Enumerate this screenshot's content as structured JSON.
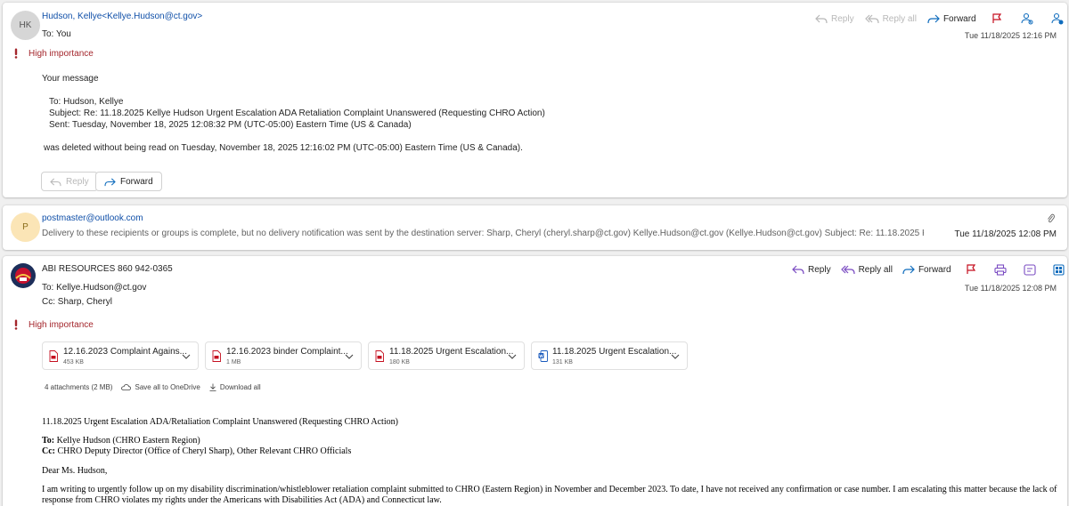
{
  "email1": {
    "avatar_initials": "HK",
    "sender": "Hudson, Kellye<Kellye.Hudson@ct.gov>",
    "to_line": "To:  You",
    "date": "Tue 11/18/2025 12:16 PM",
    "importance": "High importance",
    "actions": {
      "reply": "Reply",
      "reply_all": "Reply all",
      "forward": "Forward"
    },
    "body": {
      "your_message": "Your message",
      "to": "To: Hudson, Kellye",
      "subject": "Subject: Re: 11.18.2025 Kellye Hudson Urgent Escalation ADA Retaliation Complaint Unanswered (Requesting CHRO Action)",
      "sent": "Sent: Tuesday, November 18, 2025 12:08:32 PM (UTC-05:00) Eastern Time (US & Canada)",
      "deleted": "was deleted without being read on Tuesday, November 18, 2025 12:16:02 PM (UTC-05:00) Eastern Time (US & Canada)."
    },
    "footer_buttons": {
      "reply": "Reply",
      "forward": "Forward"
    }
  },
  "email2": {
    "avatar_initials": "P",
    "sender": "postmaster@outlook.com",
    "preview": "Delivery to these recipients or groups is complete, but no delivery notification was sent by the destination server: Sharp, Cheryl (cheryl.sharp@ct.gov) Kellye.Hudson@ct.gov (Kellye.Hudson@ct.gov) Subject: Re: 11.18.2025 Kellye Hudson ...",
    "date": "Tue 11/18/2025 12:08 PM"
  },
  "email3": {
    "sender": "ABI RESOURCES 860 942-0365",
    "to_line": "To:  Kellye.Hudson@ct.gov",
    "cc_line": "Cc:  Sharp, Cheryl",
    "date": "Tue 11/18/2025 12:08 PM",
    "importance": "High importance",
    "actions": {
      "reply": "Reply",
      "reply_all": "Reply all",
      "forward": "Forward"
    },
    "attachments": [
      {
        "name": "12.16.2023 Complaint Agains...",
        "size": "453 KB",
        "type": "pdf"
      },
      {
        "name": "12.16.2023 binder Complaint...",
        "size": "1 MB",
        "type": "pdf"
      },
      {
        "name": "11.18.2025 Urgent Escalation...",
        "size": "180 KB",
        "type": "pdf"
      },
      {
        "name": "11.18.2025 Urgent Escalation...",
        "size": "131 KB",
        "type": "word"
      }
    ],
    "attachments_summary": "4 attachments (2 MB)",
    "save_onedrive": "Save all to OneDrive",
    "download_all": "Download all",
    "body": {
      "subject_line": "11.18.2025 Urgent Escalation  ADA/Retaliation Complaint Unanswered (Requesting CHRO Action)",
      "to_label": "To:",
      "to_value": " Kellye Hudson (CHRO Eastern Region)",
      "cc_label": "Cc:",
      "cc_value": " CHRO Deputy Director (Office of Cheryl Sharp), Other Relevant CHRO Officials",
      "greeting": "Dear Ms. Hudson,",
      "paragraph_line1": "I am writing to urgently follow up on my disability discrimination/whistleblower retaliation complaint submitted to CHRO (Eastern Region) in November and December 2023. To date, I have not received any confirmation or case number. I am escalating this matter because the lack of",
      "paragraph_line2": "response from CHRO violates my rights under the Americans with Disabilities Act (ADA) and Connecticut law."
    }
  },
  "colors": {
    "accent": "#0f6cbd",
    "importance": "#a4262c",
    "flag": "#c50f1f"
  }
}
